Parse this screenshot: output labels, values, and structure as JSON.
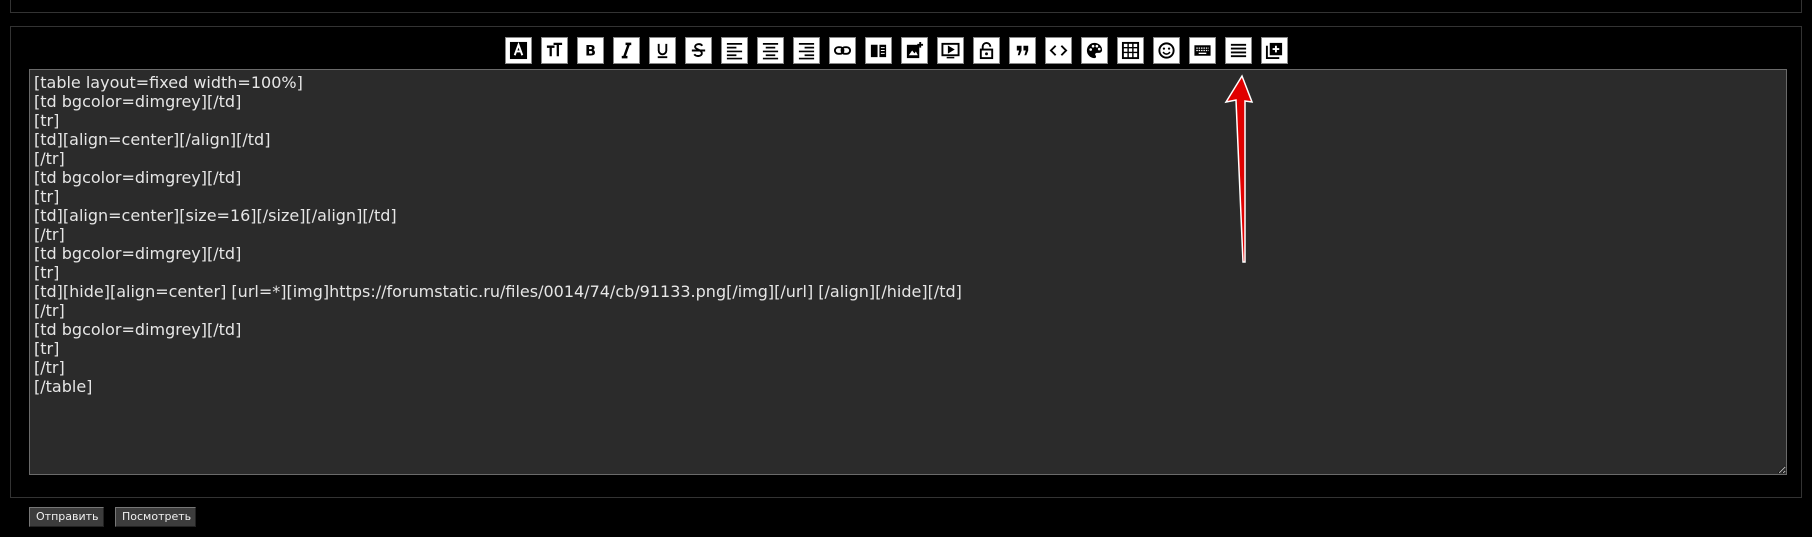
{
  "toolbar": {
    "icons": [
      "font-color-icon",
      "font-size-icon",
      "bold-icon",
      "italic-icon",
      "underline-icon",
      "strikethrough-icon",
      "align-left-icon",
      "align-center-icon",
      "align-right-icon",
      "link-icon",
      "book-icon",
      "add-image-icon",
      "video-icon",
      "lock-icon",
      "quote-icon",
      "code-icon",
      "palette-icon",
      "table-icon",
      "smile-icon",
      "keyboard-icon",
      "justify-icon",
      "add-box-icon"
    ]
  },
  "editor": {
    "content": "[table layout=fixed width=100%]\n[td bgcolor=dimgrey][/td]\n[tr]\n[td][align=center][/align][/td]\n[/tr]\n[td bgcolor=dimgrey][/td]\n[tr]\n[td][align=center][size=16][/size][/align][/td]\n[/tr]\n[td bgcolor=dimgrey][/td]\n[tr]\n[td][hide][align=center] [url=*][img]https://forumstatic.ru/files/0014/74/cb/91133.png[/img][/url] [/align][/hide][/td]\n[/tr]\n[td bgcolor=dimgrey][/td]\n[tr]\n[/tr]\n[/table]"
  },
  "buttons": {
    "submit": "Отправить",
    "preview": "Посмотреть"
  },
  "colors": {
    "annotation_arrow": "#e00000"
  }
}
